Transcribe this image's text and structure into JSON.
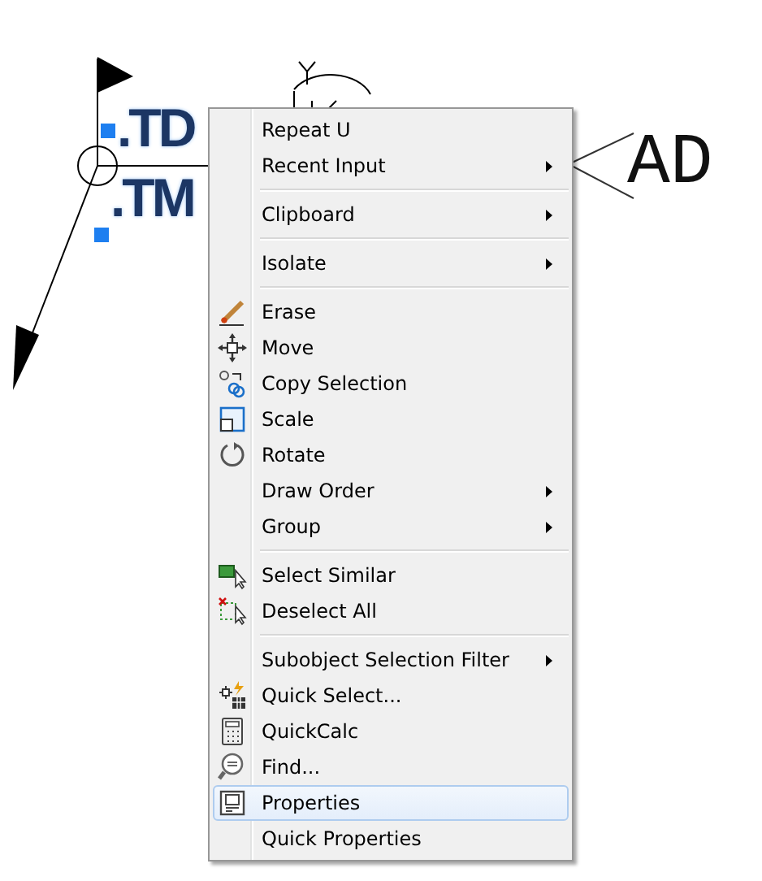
{
  "canvas": {
    "labels": [
      {
        "text": ".TD"
      },
      {
        "text": ".TM"
      }
    ],
    "tag": {
      "text": "AD"
    }
  },
  "context_menu": {
    "items": [
      {
        "kind": "command",
        "label": "Repeat U",
        "has_submenu": false,
        "selected": false
      },
      {
        "kind": "command",
        "label": "Recent Input",
        "has_submenu": true,
        "selected": false
      },
      {
        "kind": "separator"
      },
      {
        "kind": "command",
        "label": "Clipboard",
        "has_submenu": true,
        "selected": false
      },
      {
        "kind": "separator"
      },
      {
        "kind": "command",
        "label": "Isolate",
        "has_submenu": true,
        "selected": false
      },
      {
        "kind": "separator"
      },
      {
        "kind": "command",
        "label": "Erase",
        "has_submenu": false,
        "selected": false
      },
      {
        "kind": "command",
        "label": "Move",
        "has_submenu": false,
        "selected": false
      },
      {
        "kind": "command",
        "label": "Copy Selection",
        "has_submenu": false,
        "selected": false
      },
      {
        "kind": "command",
        "label": "Scale",
        "has_submenu": false,
        "selected": false
      },
      {
        "kind": "command",
        "label": "Rotate",
        "has_submenu": false,
        "selected": false
      },
      {
        "kind": "command",
        "label": "Draw Order",
        "has_submenu": true,
        "selected": false
      },
      {
        "kind": "command",
        "label": "Group",
        "has_submenu": true,
        "selected": false
      },
      {
        "kind": "separator"
      },
      {
        "kind": "command",
        "label": "Select Similar",
        "has_submenu": false,
        "selected": false
      },
      {
        "kind": "command",
        "label": "Deselect All",
        "has_submenu": false,
        "selected": false
      },
      {
        "kind": "separator"
      },
      {
        "kind": "command",
        "label": "Subobject Selection Filter",
        "has_submenu": true,
        "selected": false
      },
      {
        "kind": "command",
        "label": "Quick Select...",
        "has_submenu": false,
        "selected": false
      },
      {
        "kind": "command",
        "label": "QuickCalc",
        "has_submenu": false,
        "selected": false
      },
      {
        "kind": "command",
        "label": "Find...",
        "has_submenu": false,
        "selected": false
      },
      {
        "kind": "command",
        "label": "Properties",
        "has_submenu": false,
        "selected": true
      },
      {
        "kind": "command",
        "label": "Quick Properties",
        "has_submenu": false,
        "selected": false
      }
    ]
  }
}
